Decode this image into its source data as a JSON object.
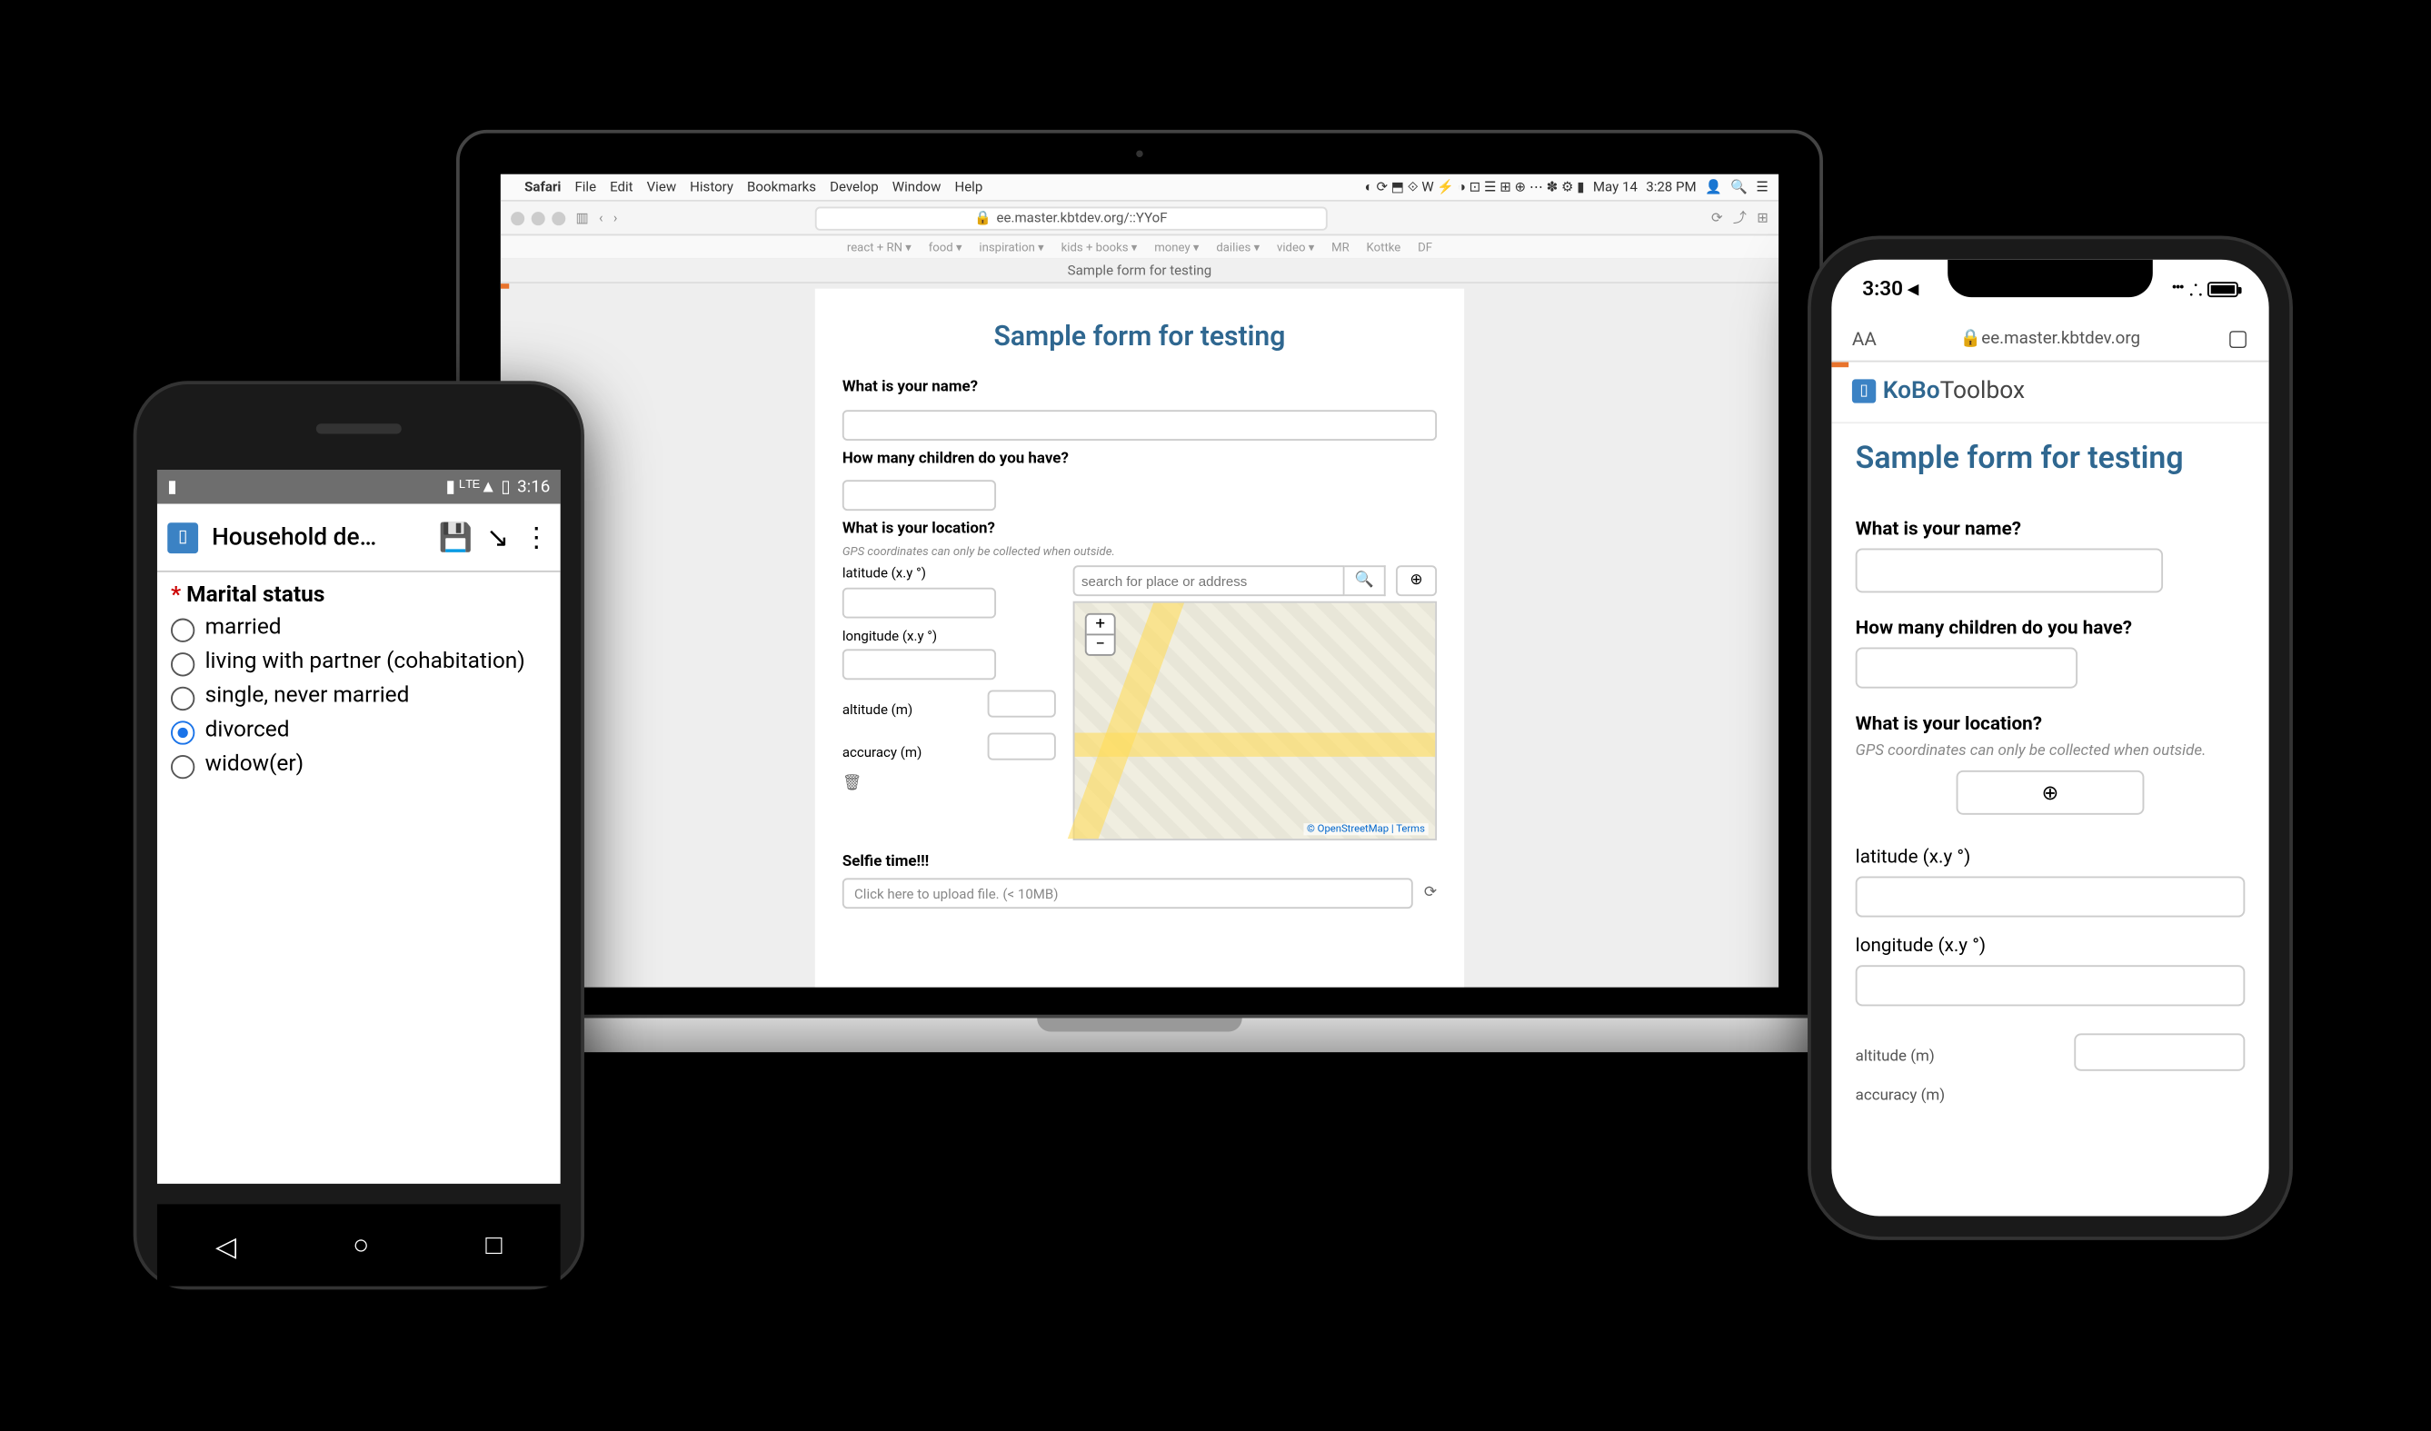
{
  "android": {
    "status_time": "3:16",
    "status_icons": "▮  ᴸᵀᴱ▲  ▯",
    "app_title": "Household de…",
    "question": "Marital status",
    "options": [
      {
        "label": "married",
        "checked": false
      },
      {
        "label": "living with partner (cohabitation)",
        "checked": false
      },
      {
        "label": "single, never married",
        "checked": false
      },
      {
        "label": "divorced",
        "checked": true
      },
      {
        "label": "widow(er)",
        "checked": false
      }
    ]
  },
  "laptop": {
    "menubar": {
      "items": [
        "Safari",
        "File",
        "Edit",
        "View",
        "History",
        "Bookmarks",
        "Develop",
        "Window",
        "Help"
      ],
      "right_date": "May 14",
      "right_time": "3:28 PM"
    },
    "url": "ee.master.kbtdev.org/::YYoF",
    "favorites": [
      "react + RN ▾",
      "food ▾",
      "inspiration ▾",
      "kids + books ▾",
      "money ▾",
      "dailies ▾",
      "video ▾",
      "MR",
      "Kottke",
      "DF"
    ],
    "tab_title": "Sample form for testing",
    "form": {
      "title": "Sample form for testing",
      "q_name": "What is your name?",
      "q_children": "How many children do you have?",
      "q_location": "What is your location?",
      "loc_hint": "GPS coordinates can only be collected when outside.",
      "lat_label": "latitude (x.y °)",
      "lon_label": "longitude (x.y °)",
      "alt_label": "altitude (m)",
      "acc_label": "accuracy (m)",
      "search_placeholder": "search for place or address",
      "map_attrib": "© OpenStreetMap | Terms",
      "q_selfie": "Selfie time!!!",
      "upload_placeholder": "Click here to upload file. (< 10MB)"
    }
  },
  "iphone": {
    "status_time": "3:30 ◂",
    "url": "ee.master.kbtdev.org",
    "kobo_brand_a": "KoBo",
    "kobo_brand_b": "Toolbox",
    "form": {
      "title": "Sample form for testing",
      "q_name": "What is your name?",
      "q_children": "How many children do you have?",
      "q_location": "What is your location?",
      "loc_hint": "GPS coordinates can only be collected when outside.",
      "lat_label": "latitude (x.y °)",
      "lon_label": "longitude (x.y °)",
      "alt_label": "altitude (m)",
      "acc_label": "accuracy (m)"
    }
  }
}
